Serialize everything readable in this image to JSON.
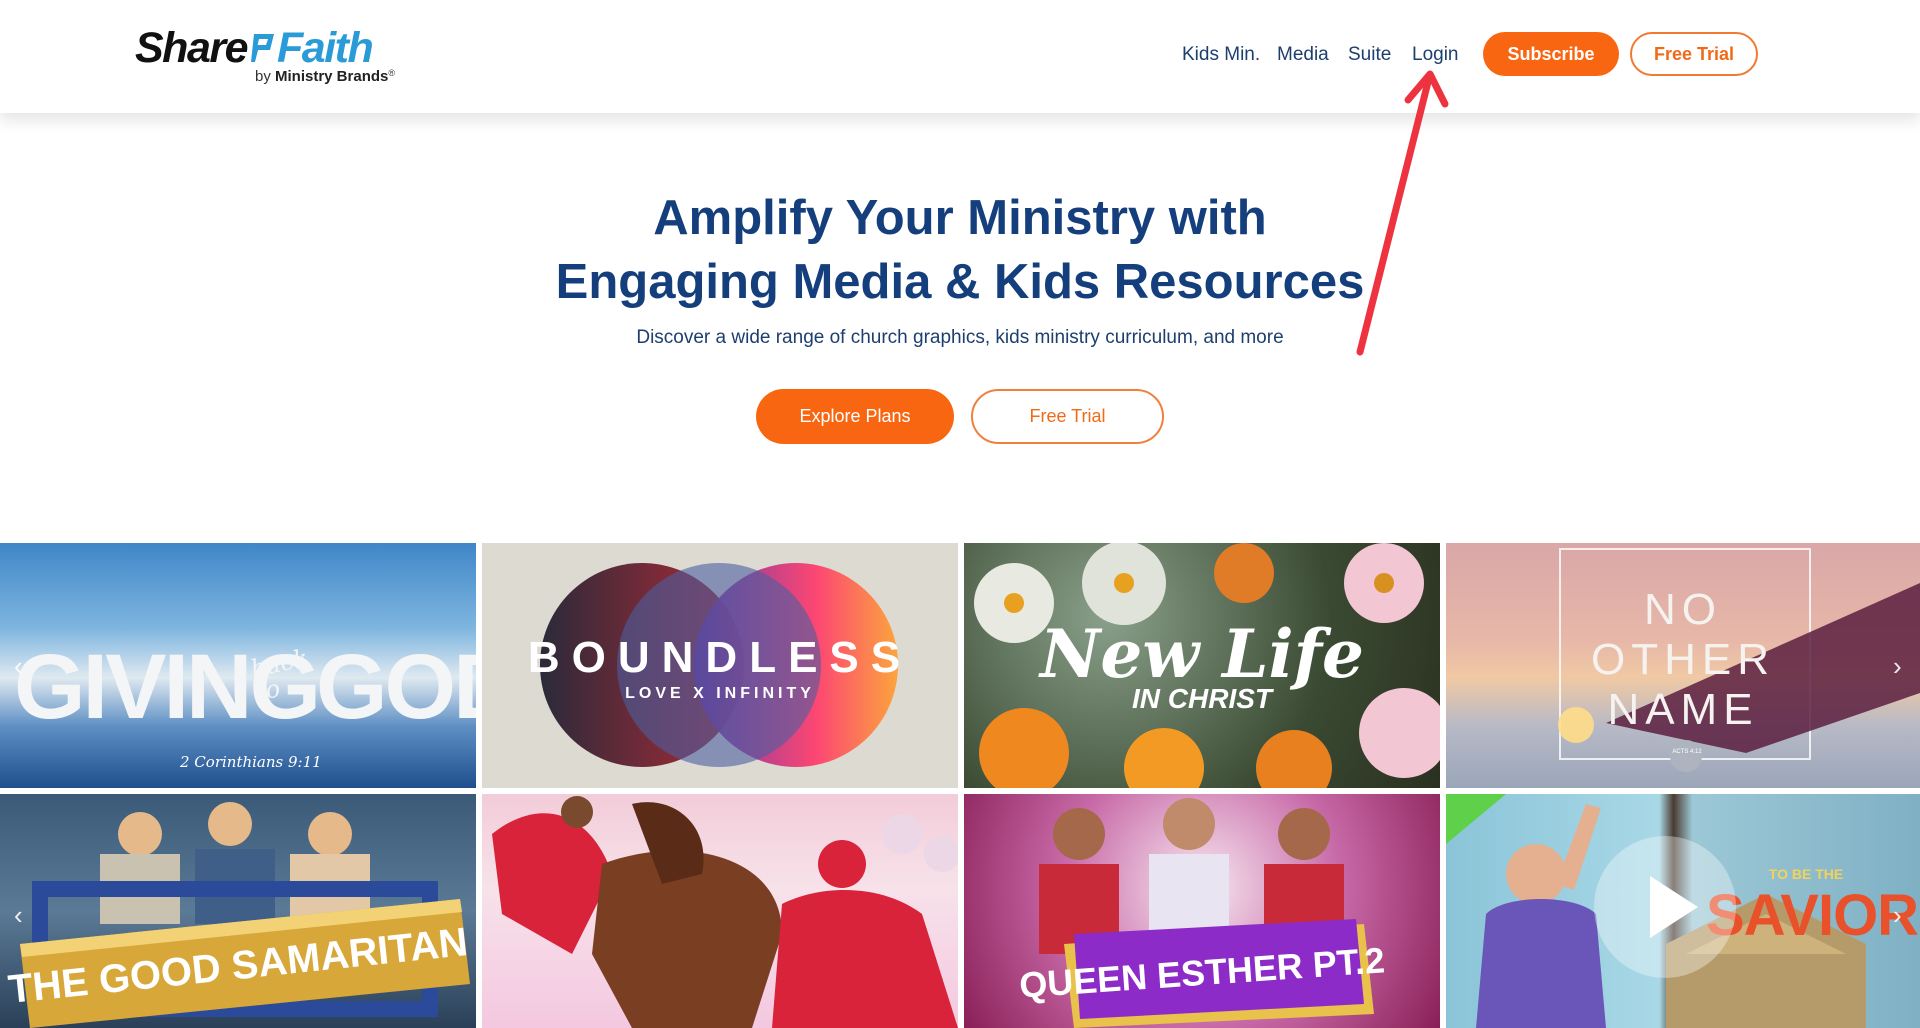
{
  "logo": {
    "share": "Share",
    "faith": "Faith",
    "sub_by": "by",
    "sub_brand": "Ministry Brands",
    "sub_tm": "®"
  },
  "nav": {
    "kids": "Kids Min.",
    "media": "Media",
    "suite": "Suite",
    "login": "Login"
  },
  "header_buttons": {
    "subscribe": "Subscribe",
    "free_trial": "Free Trial"
  },
  "hero": {
    "title_line1": "Amplify Your Ministry with",
    "title_line2": "Engaging Media & Kids Resources",
    "subtitle": "Discover a wide range of church graphics, kids ministry curriculum, and more",
    "explore": "Explore Plans",
    "trial": "Free Trial"
  },
  "gallery_row1": [
    {
      "title": "GIVING",
      "script": "back to",
      "title2": "GOD",
      "verse": "2 Corinthians 9:11"
    },
    {
      "title": "BOUNDLESS",
      "sub": "LOVE X INFINITY"
    },
    {
      "title": "New Life",
      "sub": "IN CHRIST"
    },
    {
      "line1": "NO",
      "line2": "OTHER",
      "line3": "NAME",
      "badge": "ACTS 4:12"
    }
  ],
  "gallery_row2": [
    {
      "title": "THE GOOD SAMARITAN"
    },
    {
      "title": ""
    },
    {
      "title": "QUEEN ESTHER PT.2"
    },
    {
      "title": "SAVIOR",
      "small": "TO BE THE"
    }
  ],
  "icons": {
    "prev": "chevron-left-icon",
    "next": "chevron-right-icon",
    "play": "play-icon"
  },
  "colors": {
    "accent": "#f86611",
    "navy": "#143f7c",
    "annotation": "#ee3340"
  }
}
